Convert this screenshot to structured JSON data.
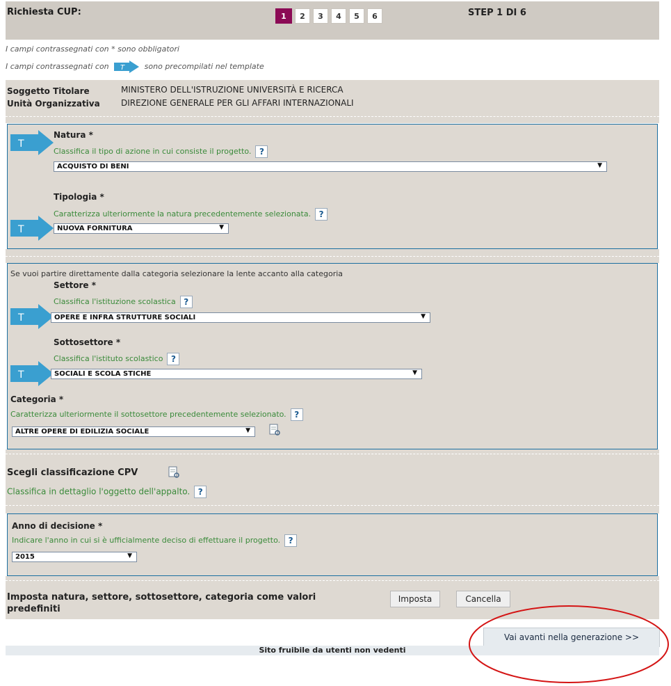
{
  "header": {
    "title": "Richiesta CUP:",
    "steps": [
      "1",
      "2",
      "3",
      "4",
      "5",
      "6"
    ],
    "active_step": "1",
    "step_info": "STEP 1 DI 6"
  },
  "notes": {
    "required": "I campi contrassegnati con * sono obbligatori",
    "template_prefix": "I campi contrassegnati con",
    "template_suffix": "sono precompilati nel template",
    "template_icon_letter": "T"
  },
  "soggetto": {
    "titolare_label": "Soggetto Titolare",
    "titolare_value": "MINISTERO DELL'ISTRUZIONE UNIVERSITÀ E RICERCA",
    "unita_label": "Unità Organizzativa",
    "unita_value": "DIREZIONE GENERALE PER GLI AFFARI INTERNAZIONALI"
  },
  "natura": {
    "label": "Natura *",
    "hint": "Classifica il tipo di azione in cui consiste il progetto.",
    "value": "ACQUISTO DI BENI"
  },
  "tipologia": {
    "label": "Tipologia *",
    "hint": "Caratterizza ulteriormente la natura precedentemente selezionata.",
    "value": "NUOVA FORNITURA"
  },
  "categoria_intro": "Se vuoi partire direttamente dalla categoria selezionare la lente accanto alla categoria",
  "settore": {
    "label": "Settore *",
    "hint": "Classifica l'istituzione scolastica",
    "value": "OPERE E INFRA STRUTTURE SOCIALI"
  },
  "sottosettore": {
    "label": "Sottosettore *",
    "hint": "Classifica l'istituto scolastico",
    "value": "SOCIALI E SCOLA STICHE"
  },
  "categoria": {
    "label": "Categoria *",
    "hint": "Caratterizza ulteriormente il sottosettore precedentemente selezionato.",
    "value": "ALTRE OPERE DI EDILIZIA SOCIALE"
  },
  "cpv": {
    "label": "Scegli classificazione CPV",
    "hint": "Classifica in dettaglio l'oggetto dell'appalto."
  },
  "anno": {
    "label": "Anno di decisione *",
    "hint": "Indicare l'anno in cui si è ufficialmente deciso di effettuare il progetto.",
    "value": "2015"
  },
  "defaults": {
    "text": "Imposta natura, settore, sottosettore, categoria come valori predefiniti",
    "imposta": "Imposta",
    "cancella": "Cancella"
  },
  "next_button": "Vai avanti nella generazione >>",
  "footer": "Sito fruibile da utenti non vedenti",
  "help_symbol": "?",
  "select_arrow": "▼",
  "colors": {
    "accent": "#8b0a55",
    "panel": "#ded9d2",
    "border": "#1a6ea0",
    "hint": "#3a8a3a",
    "template_arrow": "#3a9fd0",
    "highlight_circle": "#d41414"
  }
}
